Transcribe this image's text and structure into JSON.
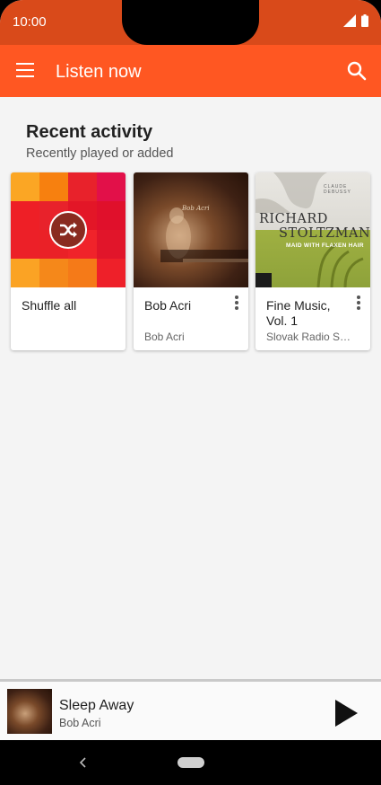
{
  "status_bar": {
    "time": "10:00"
  },
  "app_bar": {
    "title": "Listen now"
  },
  "section": {
    "title": "Recent activity",
    "subtitle": "Recently played or added"
  },
  "cards": [
    {
      "title": "Shuffle all",
      "subtitle": ""
    },
    {
      "title": "Bob Acri",
      "subtitle": "Bob Acri",
      "art_text": "Bob Acri"
    },
    {
      "title": "Fine Music, Vol. 1",
      "subtitle": "Slovak Radio Symphony Orchestra",
      "art": {
        "top": "CLAUDE DEBUSSY",
        "name1": "RICHARD",
        "name2": "STOLTZMAN",
        "band": "MAID WITH FLAXEN HAIR"
      }
    }
  ],
  "mini_player": {
    "title": "Sleep Away",
    "artist": "Bob Acri"
  },
  "colors": {
    "status_bar": "#d94a1a",
    "app_bar": "#ff5722",
    "background": "#f4f4f4"
  }
}
